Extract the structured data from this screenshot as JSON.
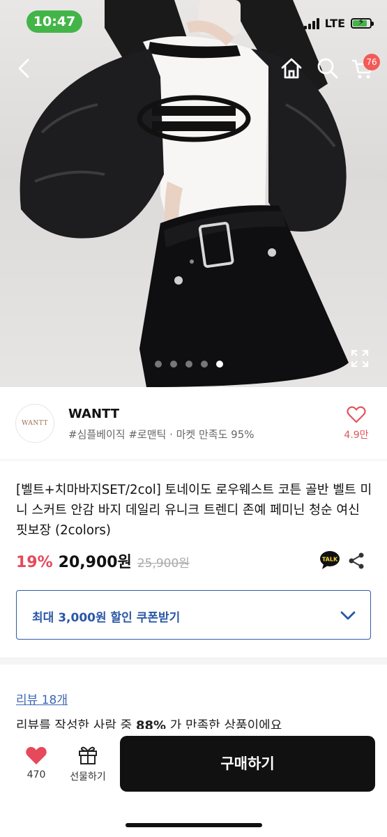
{
  "status_bar": {
    "time": "10:47",
    "network": "LTE",
    "colors": {
      "time_pill": "#43b548"
    }
  },
  "top_nav": {
    "back_icon": "chevron-left-icon",
    "home_icon": "home-icon",
    "search_icon": "search-icon",
    "cart_icon": "cart-icon",
    "cart_badge": "76"
  },
  "gallery": {
    "image_count": 5,
    "active_index": 4
  },
  "seller": {
    "logo_text": "WANTT",
    "name": "WANTT",
    "tags": "#심플베이직 #로맨틱 · 마켓 만족도 95%",
    "like_count": "4.9만"
  },
  "product": {
    "title": "[벨트+치마바지SET/2col] 토네이도 로우웨스트 코튼 골반 벨트 미니 스커트 안감 바지 데일리 유니크 트렌디 존예 페미닌 청순 여신 핏보장 (2colors)",
    "discount": "19%",
    "price": "20,900원",
    "original_price": "25,900원",
    "talk_label": "TALK"
  },
  "coupon": {
    "label": "최대 3,000원 할인 쿠폰받기"
  },
  "reviews": {
    "link": "리뷰 18개",
    "summary_prefix": "리뷰를 작성한 사람 중 ",
    "summary_percent": "88%",
    "summary_suffix": "가 만족한 상품이에요"
  },
  "bottom_bar": {
    "wish_count": "470",
    "gift_label": "선물하기",
    "buy_label": "구매하기"
  },
  "colors": {
    "accent_red": "#e6495a",
    "coupon_blue": "#2a58a6",
    "buy_button": "#111111"
  }
}
